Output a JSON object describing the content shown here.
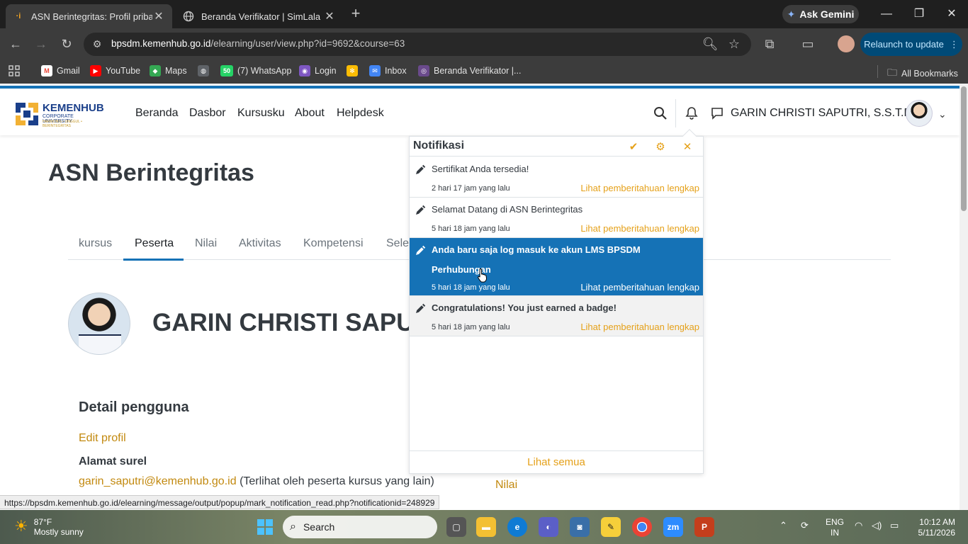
{
  "browser": {
    "tabs": [
      {
        "title": "ASN Berintegritas: Profil pribadi",
        "active": true
      },
      {
        "title": "Beranda Verifikator | SimLala",
        "active": false
      }
    ],
    "ask_gemini": "Ask Gemini",
    "url_host": "bpsdm.kemenhub.go.id",
    "url_path": "/elearning/user/view.php?id=9692&course=63",
    "relaunch": "Relaunch to update",
    "bookmarks": [
      "Gmail",
      "YouTube",
      "Maps",
      "(7) WhatsApp",
      "Login",
      "Inbox",
      "Beranda Verifikator |..."
    ],
    "whatsapp_badge": "50",
    "all_bookmarks": "All Bookmarks"
  },
  "site": {
    "logo_line1": "KEMENHUB",
    "logo_line2": "CORPORATE UNIVERSITY",
    "logo_line3": "HARMONIS • UNGGUL • BERINTEGRITAS",
    "nav": [
      "Beranda",
      "Dasbor",
      "Kursusku",
      "About",
      "Helpdesk"
    ],
    "user_name": "GARIN CHRISTI SAPUTRI, S.S.T.Pel"
  },
  "course": {
    "title": "ASN Berintegritas",
    "tabs": [
      "kursus",
      "Peserta",
      "Nilai",
      "Aktivitas",
      "Kompetensi",
      "Sele"
    ],
    "active_tab": "Peserta"
  },
  "profile": {
    "full_name": "GARIN CHRISTI SAPUTRI",
    "detail_heading": "Detail pengguna",
    "edit_profile": "Edit profil",
    "email_label": "Alamat surel",
    "email": "garin_saputri@kemenhub.go.id",
    "email_note": "(Terlihat oleh peserta kursus yang lain)",
    "grades_link": "Nilai"
  },
  "notifications": {
    "title": "Notifikasi",
    "items": [
      {
        "text": "Sertifikat Anda tersedia!",
        "time": "2 hari 17 jam yang lalu",
        "link": "Lihat pemberitahuan lengkap",
        "state": "read"
      },
      {
        "text": "Selamat Datang di ASN Berintegritas",
        "time": "5 hari 18 jam yang lalu",
        "link": "Lihat pemberitahuan lengkap",
        "state": "read"
      },
      {
        "text": "Anda baru saja log masuk ke akun LMS BPSDM Perhubungan",
        "time": "5 hari 18 jam yang lalu",
        "link": "Lihat pemberitahuan lengkap",
        "state": "hover"
      },
      {
        "text": "Congratulations! You just earned a badge!",
        "time": "5 hari 18 jam yang lalu",
        "link": "Lihat pemberitahuan lengkap",
        "state": "unread"
      }
    ],
    "see_all": "Lihat semua"
  },
  "status_bar_url": "https://bpsdm.kemenhub.go.id/elearning/message/output/popup/mark_notification_read.php?notificationid=248929",
  "taskbar": {
    "weather_temp": "87°F",
    "weather_cond": "Mostly sunny",
    "search": "Search",
    "lang1": "ENG",
    "lang2": "IN",
    "time": "10:12 AM",
    "date": "5/11/2026"
  },
  "colors": {
    "accent_blue": "#1572b6",
    "link_orange": "#e5a11a"
  }
}
